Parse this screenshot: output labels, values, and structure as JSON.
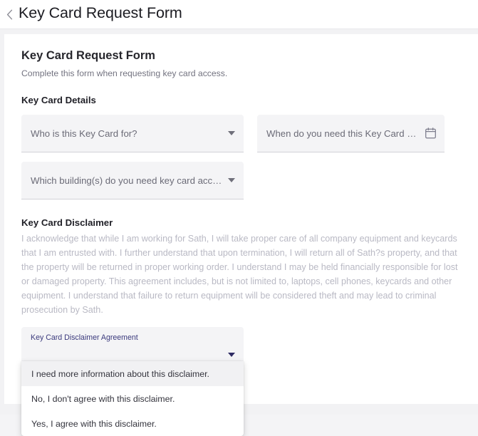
{
  "header": {
    "back_icon": "chevron-left-icon",
    "title": "Key Card Request Form"
  },
  "form": {
    "title": "Key Card Request Form",
    "subtitle": "Complete this form when requesting key card access.",
    "section_title": "Key Card Details",
    "fields": [
      {
        "label": "Who is this Key Card for?",
        "control": "dropdown",
        "icon": "chevron-down-icon"
      },
      {
        "label": "When do you need this Key Card by?",
        "control": "date",
        "icon": "calendar-icon"
      },
      {
        "label": "Which building(s) do you need key card acces...",
        "control": "dropdown",
        "icon": "chevron-down-icon"
      }
    ],
    "disclaimer": {
      "title": "Key Card Disclaimer",
      "body": "I acknowledge that while I am working for Sath, I will take proper care of all company equipment and keycards that I am entrusted with. I further understand that upon termination, I will return all of Sath?s property, and that the property will be returned in proper working order. I understand I may be held financially responsible for lost or damaged property. This agreement includes, but is not limited to, laptops, cell phones, keycards and other equipment. I understand that failure to return equipment will be considered theft and may lead to criminal prosecution by Sath."
    },
    "agreement_select": {
      "label": "Key Card Disclaimer Agreement",
      "value": "",
      "icon": "chevron-down-icon",
      "options": [
        "I need more information about this disclaimer.",
        "No, I don't agree with this disclaimer.",
        "Yes, I agree with this disclaimer."
      ],
      "highlighted_index": 0
    }
  },
  "colors": {
    "accent": "#312e6b",
    "label_accent": "#3b3a7d",
    "page_background": "#f2f2f4",
    "field_background": "#f4f4f6",
    "disclaimer_text": "#b9b9c4"
  }
}
